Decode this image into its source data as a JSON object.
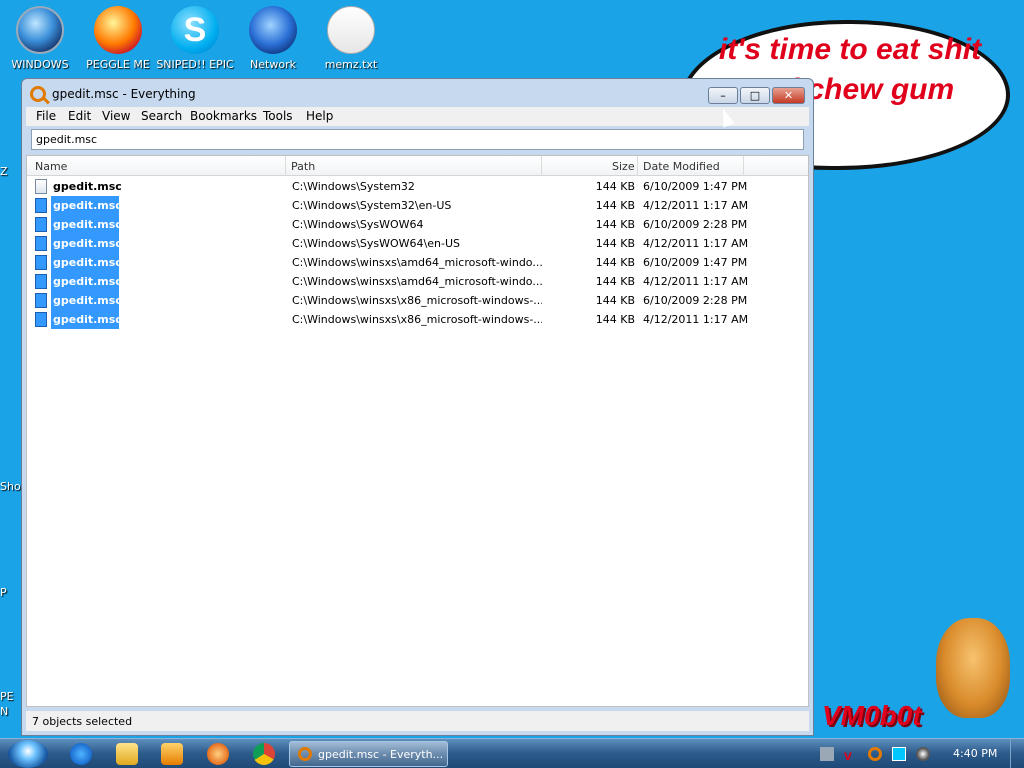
{
  "desktop": {
    "icons": [
      {
        "label": "WINDOWS",
        "icon": "windows-orb-icon"
      },
      {
        "label": "PEGGLE ME",
        "icon": "peggle-icon"
      },
      {
        "label": "SNIPED!! EPIC",
        "icon": "skype-icon",
        "glyph": "S"
      },
      {
        "label": "Network",
        "icon": "network-globe-icon"
      },
      {
        "label": "memz.txt",
        "icon": "text-file-icon"
      }
    ],
    "left_fragments": [
      "Z",
      "Sho",
      "P",
      "PE",
      "N"
    ],
    "bubble_text": "it's time to eat shit and chew gum",
    "logo_text": "VM0b0t"
  },
  "window": {
    "title": "gpedit.msc - Everything",
    "buttons": {
      "minimize": "–",
      "maximize": "□",
      "close": "✕"
    },
    "menu": [
      "File",
      "Edit",
      "View",
      "Search",
      "Bookmarks",
      "Tools",
      "Help"
    ],
    "search_value": "gpedit.msc",
    "columns": {
      "name": "Name",
      "path": "Path",
      "size": "Size",
      "date": "Date Modified"
    },
    "rows": [
      {
        "name": "gpedit.msc",
        "path": "C:\\Windows\\System32",
        "size": "144 KB",
        "date": "6/10/2009 1:47 PM",
        "selected": false
      },
      {
        "name": "gpedit.msc",
        "path": "C:\\Windows\\System32\\en-US",
        "size": "144 KB",
        "date": "4/12/2011 1:17 AM",
        "selected": true
      },
      {
        "name": "gpedit.msc",
        "path": "C:\\Windows\\SysWOW64",
        "size": "144 KB",
        "date": "6/10/2009 2:28 PM",
        "selected": true
      },
      {
        "name": "gpedit.msc",
        "path": "C:\\Windows\\SysWOW64\\en-US",
        "size": "144 KB",
        "date": "4/12/2011 1:17 AM",
        "selected": true
      },
      {
        "name": "gpedit.msc",
        "path": "C:\\Windows\\winsxs\\amd64_microsoft-windo...",
        "size": "144 KB",
        "date": "6/10/2009 1:47 PM",
        "selected": true
      },
      {
        "name": "gpedit.msc",
        "path": "C:\\Windows\\winsxs\\amd64_microsoft-windo...",
        "size": "144 KB",
        "date": "4/12/2011 1:17 AM",
        "selected": true
      },
      {
        "name": "gpedit.msc",
        "path": "C:\\Windows\\winsxs\\x86_microsoft-windows-...",
        "size": "144 KB",
        "date": "6/10/2009 2:28 PM",
        "selected": true
      },
      {
        "name": "gpedit.msc",
        "path": "C:\\Windows\\winsxs\\x86_microsoft-windows-...",
        "size": "144 KB",
        "date": "4/12/2011 1:17 AM",
        "selected": true
      }
    ],
    "status": "7 objects selected"
  },
  "taskbar": {
    "active_task": "gpedit.msc - Everyth...",
    "clock": "4:40 PM",
    "pinned": [
      "internet-explorer-icon",
      "explorer-folder-icon",
      "media-player-icon",
      "game-icon",
      "chrome-icon"
    ],
    "tray": [
      "network-tray-icon",
      "antivirus-tray-icon",
      "search-tray-icon",
      "display-tray-icon",
      "speaker-tray-icon"
    ]
  }
}
